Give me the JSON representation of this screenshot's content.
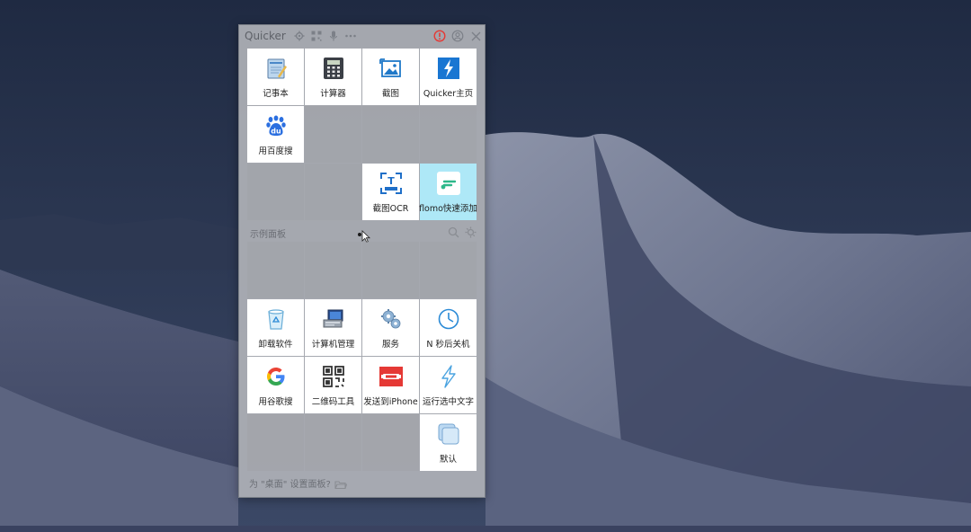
{
  "window": {
    "title": "Quicker",
    "icons": [
      "gear-icon",
      "qr-icon",
      "mic-icon",
      "more-icon",
      "alert-icon",
      "user-icon",
      "close-icon"
    ],
    "alert_color": "#e53935"
  },
  "top_panel": {
    "items": [
      {
        "label": "记事本",
        "icon": "notepad-icon"
      },
      {
        "label": "计算器",
        "icon": "calculator-icon"
      },
      {
        "label": "截图",
        "icon": "screenshot-icon"
      },
      {
        "label": "Quicker主页",
        "icon": "quicker-home-icon"
      },
      {
        "label": "用百度搜",
        "icon": "baidu-icon"
      },
      {
        "label": "截图OCR",
        "icon": "ocr-icon"
      },
      {
        "label": "flomo快速添加",
        "icon": "flomo-icon"
      }
    ]
  },
  "section": {
    "title": "示例面板"
  },
  "bottom_panel": {
    "items": [
      {
        "label": "卸载软件",
        "icon": "recycle-bin-icon"
      },
      {
        "label": "计算机管理",
        "icon": "computer-management-icon"
      },
      {
        "label": "服务",
        "icon": "services-gear-icon"
      },
      {
        "label": "N 秒后关机",
        "icon": "clock-icon"
      },
      {
        "label": "用谷歌搜",
        "icon": "google-icon"
      },
      {
        "label": "二维码工具",
        "icon": "qrcode-icon"
      },
      {
        "label": "发送到iPhone",
        "icon": "send-to-iphone-icon"
      },
      {
        "label": "运行选中文字",
        "icon": "lightning-icon"
      },
      {
        "label": "默认",
        "icon": "default-panel-icon"
      }
    ]
  },
  "footer": {
    "text": "为 \"桌面\" 设置面板?"
  },
  "colors": {
    "highlight": "#aee8f7",
    "accent_blue": "#2b8ad6"
  }
}
